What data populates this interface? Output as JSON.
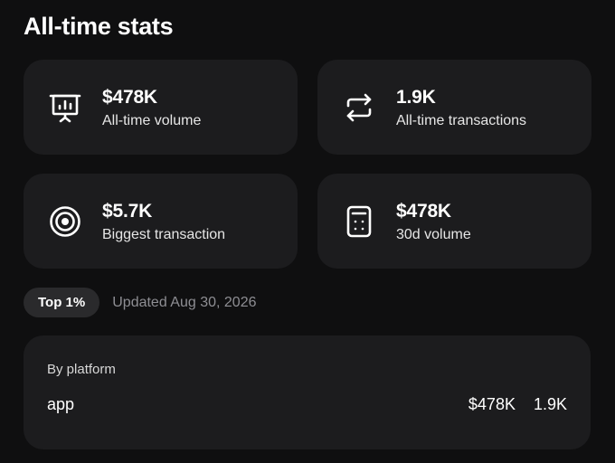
{
  "header": {
    "title": "All-time stats"
  },
  "stats": [
    {
      "value": "$478K",
      "label": "All-time volume",
      "icon": "presentation-chart-icon"
    },
    {
      "value": "1.9K",
      "label": "All-time transactions",
      "icon": "repeat-arrows-icon"
    },
    {
      "value": "$5.7K",
      "label": "Biggest transaction",
      "icon": "target-icon"
    },
    {
      "value": "$478K",
      "label": "30d volume",
      "icon": "calculator-icon"
    }
  ],
  "rank": {
    "badge": "Top 1%",
    "updated": "Updated Aug 30, 2026"
  },
  "platform": {
    "heading": "By platform",
    "rows": [
      {
        "name": "app",
        "volume": "$478K",
        "transactions": "1.9K"
      }
    ]
  },
  "colors": {
    "background": "#0f0f10",
    "card": "#1c1c1e",
    "badge": "#2a2a2c",
    "muted_text": "#8e8e93"
  }
}
